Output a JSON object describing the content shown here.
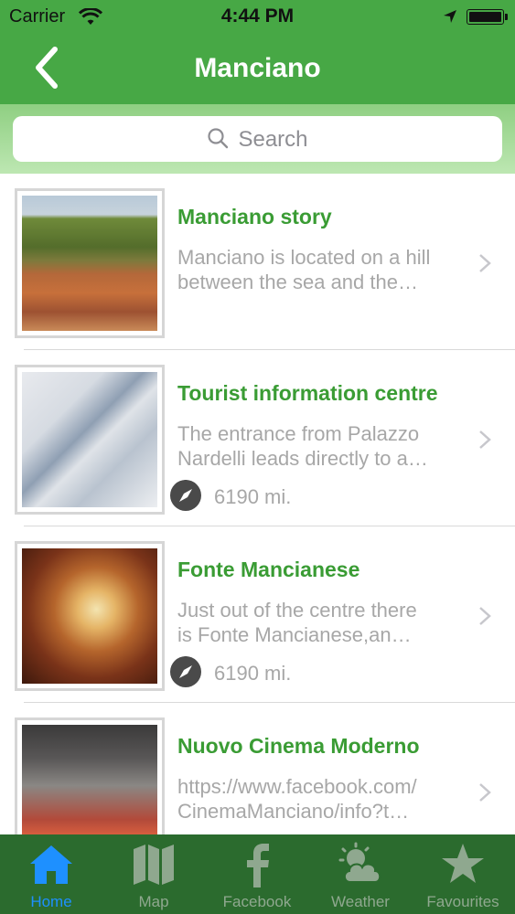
{
  "status_bar": {
    "carrier": "Carrier",
    "time": "4:44 PM"
  },
  "nav": {
    "title": "Manciano"
  },
  "search": {
    "placeholder": "Search"
  },
  "items": [
    {
      "title": "Manciano story",
      "desc_line1": "Manciano is located on a hill",
      "desc_line2": "between the sea and the…",
      "distance": ""
    },
    {
      "title": "Tourist information centre",
      "desc_line1": "The entrance from Palazzo",
      "desc_line2": "Nardelli leads directly to a…",
      "distance": "6190 mi."
    },
    {
      "title": "Fonte Mancianese",
      "desc_line1": "Just out of the centre there",
      "desc_line2": "is Fonte Mancianese,an…",
      "distance": "6190 mi."
    },
    {
      "title": "Nuovo Cinema Moderno",
      "desc_line1": "https://www.facebook.com/",
      "desc_line2": "CinemaManciano/info?t…",
      "distance": ""
    }
  ],
  "tabs": [
    {
      "label": "Home",
      "icon": "home-icon",
      "active": true
    },
    {
      "label": "Map",
      "icon": "map-icon",
      "active": false
    },
    {
      "label": "Facebook",
      "icon": "facebook-icon",
      "active": false
    },
    {
      "label": "Weather",
      "icon": "weather-icon",
      "active": false
    },
    {
      "label": "Favourites",
      "icon": "star-icon",
      "active": false
    }
  ],
  "colors": {
    "brand_green": "#47a845",
    "title_green": "#3a9c34",
    "tabbar": "#2b6b2e",
    "tab_active": "#1e90ff"
  }
}
